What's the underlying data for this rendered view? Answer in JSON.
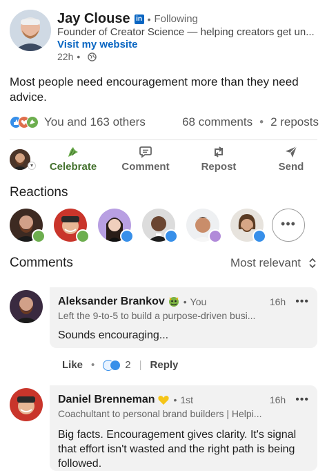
{
  "post": {
    "author": {
      "name": "Jay Clouse",
      "badge": "in",
      "follow_state": "Following",
      "headline": "Founder of Creator Science — helping creators get un...",
      "website_link": "Visit my website",
      "time": "22h",
      "visibility_icon": "globe-icon"
    },
    "text": "Most people need encouragement more than they need advice.",
    "counts": {
      "reactions": "You and 163 others",
      "comments": "68 comments",
      "reposts": "2 reposts"
    }
  },
  "actions": {
    "celebrate": "Celebrate",
    "comment": "Comment",
    "repost": "Repost",
    "send": "Send"
  },
  "reactions_section": {
    "title": "Reactions",
    "more_label": "•••"
  },
  "comments_section": {
    "title": "Comments",
    "sort": "Most relevant",
    "items": [
      {
        "name": "Aleksander Brankov",
        "relation": "You",
        "time": "16h",
        "headline": "Left the 9-to-5 to build a purpose-driven busi...",
        "text": "Sounds encouraging...",
        "like_label": "Like",
        "reaction_count": "2",
        "reply_label": "Reply"
      },
      {
        "name": "Daniel Brenneman",
        "relation": "1st",
        "time": "16h",
        "headline": "Coachultant to personal brand builders | Helpi...",
        "text": "Big facts. Encouragement gives clarity. It's signal that effort isn't wasted and the right path is being followed."
      }
    ]
  },
  "colors": {
    "linkedin_blue": "#0a66c2",
    "celebrate_green": "#44712e",
    "like_blue": "#378fe9",
    "bubble_bg": "#f2f2f2"
  }
}
